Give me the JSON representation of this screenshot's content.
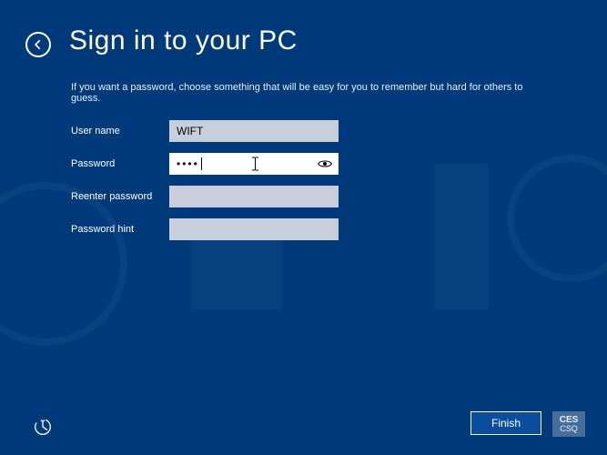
{
  "header": {
    "title": "Sign in to your PC",
    "back_icon": "back-arrow"
  },
  "instruction": "If you want a password, choose something that will be easy for you to remember but hard for others to guess.",
  "fields": {
    "username": {
      "label": "User name",
      "value": "WIFT"
    },
    "password": {
      "label": "Password",
      "masked_value": "••••"
    },
    "reenter": {
      "label": "Reenter password",
      "value": ""
    },
    "hint": {
      "label": "Password hint",
      "value": ""
    }
  },
  "footer": {
    "finish_label": "Finish",
    "keyboard_layout": {
      "line1": "CES",
      "line2": "CSQ"
    }
  }
}
